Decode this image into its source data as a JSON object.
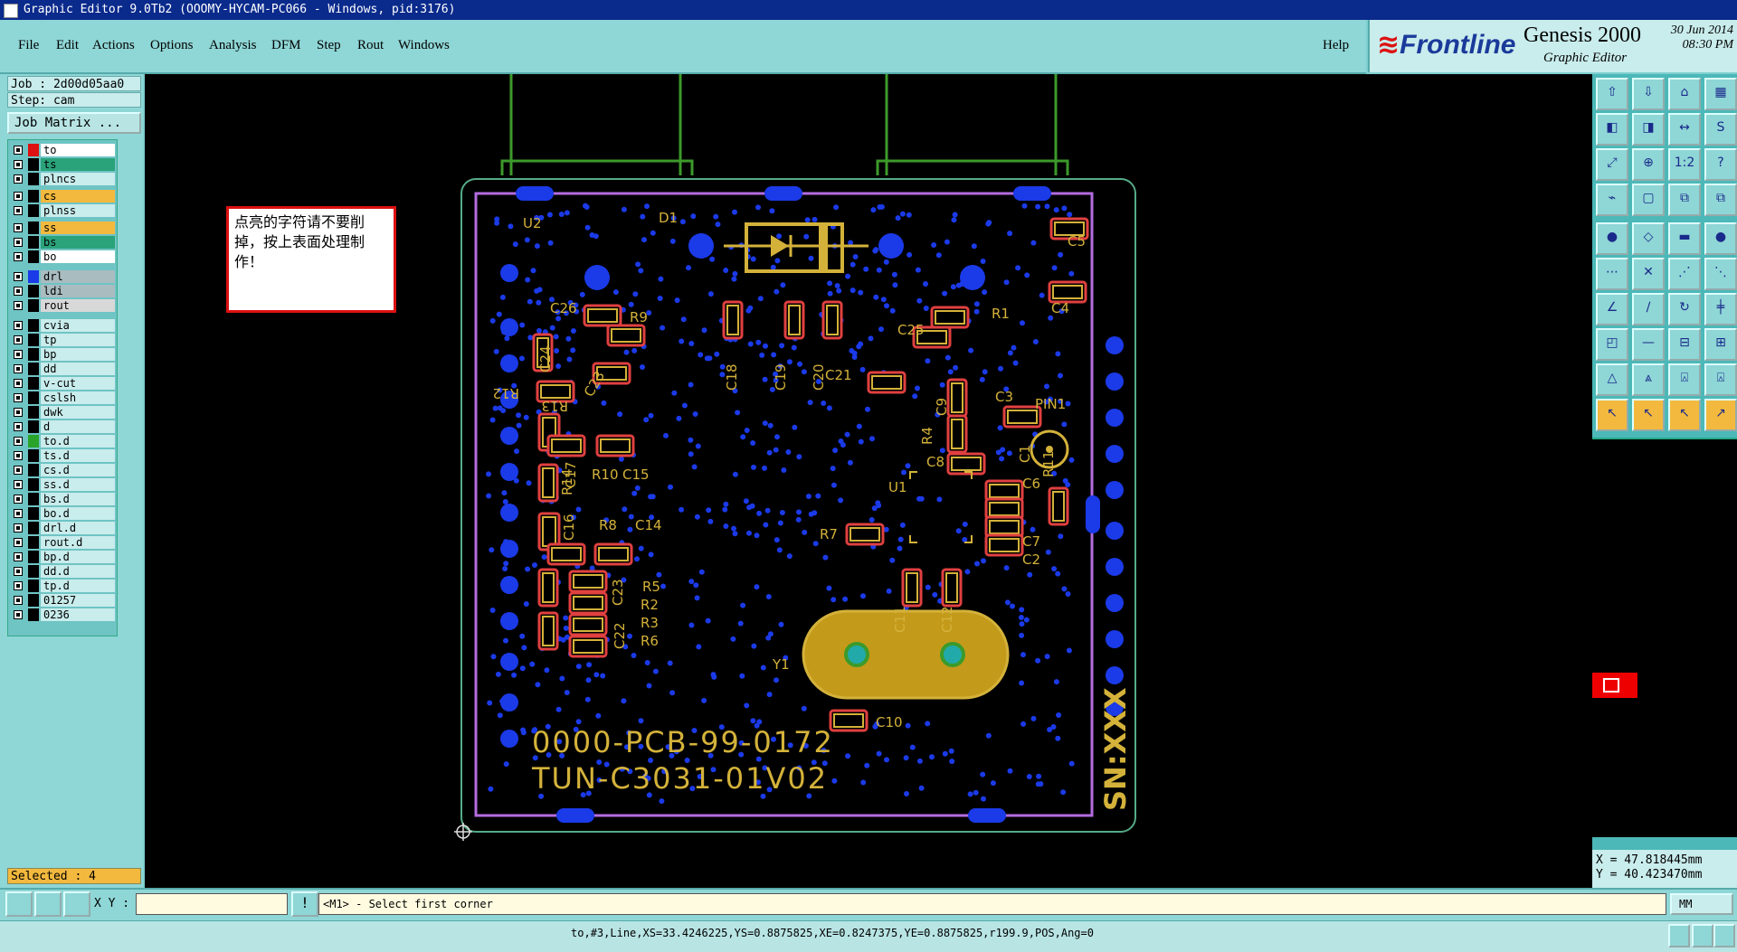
{
  "title_bar": {
    "text": "Graphic Editor 9.0Tb2 (OOOMY-HYCAM-PC066 - Windows, pid:3176)"
  },
  "menus": [
    "File",
    "Edit",
    "Actions",
    "Options",
    "Analysis",
    "DFM",
    "Step",
    "Rout",
    "Windows"
  ],
  "help_label": "Help",
  "brand": {
    "logo_text": "Frontline",
    "product": "Genesis 2000",
    "subtitle": "Graphic Editor",
    "date": "30 Jun 2014",
    "time": "08:30 PM"
  },
  "job": {
    "job_label": "Job : 2d00d05aa0",
    "step_label": "Step: cam",
    "matrix_button": "Job Matrix ..."
  },
  "layers": [
    {
      "name": "to",
      "bg": "#ffffff",
      "sw": "#d11"
    },
    {
      "name": "ts",
      "bg": "#2aa37a",
      "sw": "#000"
    },
    {
      "name": "plncs",
      "bg": "#c9ecec",
      "sw": "#000"
    },
    {
      "name": "cs",
      "bg": "#f3b93e",
      "sw": "#000"
    },
    {
      "name": "plnss",
      "bg": "#c9ecec",
      "sw": "#000"
    },
    {
      "name": "ss",
      "bg": "#f3b93e",
      "sw": "#000"
    },
    {
      "name": "bs",
      "bg": "#2aa37a",
      "sw": "#000"
    },
    {
      "name": "bo",
      "bg": "#ffffff",
      "sw": "#000"
    },
    {
      "name": "drl",
      "bg": "#a9bcc0",
      "sw": "#1b3ae8"
    },
    {
      "name": "ldi",
      "bg": "#a9bcc0",
      "sw": "#000"
    },
    {
      "name": "rout",
      "bg": "#d8d8d8",
      "sw": "#000"
    },
    {
      "name": "cvia",
      "bg": "#c9ecec",
      "sw": "#000"
    },
    {
      "name": "tp",
      "bg": "#c9ecec",
      "sw": "#000"
    },
    {
      "name": "bp",
      "bg": "#c9ecec",
      "sw": "#000"
    },
    {
      "name": "dd",
      "bg": "#c9ecec",
      "sw": "#000"
    },
    {
      "name": "v-cut",
      "bg": "#c9ecec",
      "sw": "#000"
    },
    {
      "name": "cslsh",
      "bg": "#c9ecec",
      "sw": "#000"
    },
    {
      "name": "dwk",
      "bg": "#c9ecec",
      "sw": "#000"
    },
    {
      "name": "d",
      "bg": "#c9ecec",
      "sw": "#000"
    },
    {
      "name": "to.d",
      "bg": "#c9ecec",
      "sw": "#2aa32a"
    },
    {
      "name": "ts.d",
      "bg": "#c9ecec",
      "sw": "#000"
    },
    {
      "name": "cs.d",
      "bg": "#c9ecec",
      "sw": "#000"
    },
    {
      "name": "ss.d",
      "bg": "#c9ecec",
      "sw": "#000"
    },
    {
      "name": "bs.d",
      "bg": "#c9ecec",
      "sw": "#000"
    },
    {
      "name": "bo.d",
      "bg": "#c9ecec",
      "sw": "#000"
    },
    {
      "name": "drl.d",
      "bg": "#c9ecec",
      "sw": "#000"
    },
    {
      "name": "rout.d",
      "bg": "#c9ecec",
      "sw": "#000"
    },
    {
      "name": "bp.d",
      "bg": "#c9ecec",
      "sw": "#000"
    },
    {
      "name": "dd.d",
      "bg": "#c9ecec",
      "sw": "#000"
    },
    {
      "name": "tp.d",
      "bg": "#c9ecec",
      "sw": "#000"
    },
    {
      "name": "01257",
      "bg": "#c9ecec",
      "sw": "#000"
    },
    {
      "name": "0236",
      "bg": "#c9ecec",
      "sw": "#000"
    }
  ],
  "selected_label": "Selected : 4",
  "note_text": "点亮的字符请不要削掉，按上表面处理制作！",
  "pcb": {
    "text_line1": "0000-PCB-99-0172",
    "text_line2": "TUN-C3031-01V02",
    "sn_text": "SN:XXX",
    "labels": [
      "U2",
      "D1",
      "C5",
      "C4",
      "C26",
      "R9",
      "C24",
      "C23",
      "R12",
      "R13",
      "C18",
      "C19",
      "C20",
      "C21",
      "C25",
      "R1",
      "C9",
      "C3",
      "PIN1",
      "R4",
      "C8",
      "C1",
      "R11",
      "C6",
      "U1",
      "C17",
      "R10",
      "C15",
      "R14",
      "C16",
      "R8",
      "C14",
      "R7",
      "C7",
      "C2",
      "C23",
      "R5",
      "R2",
      "R3",
      "R6",
      "C22",
      "C11",
      "C12",
      "Y1",
      "C10"
    ]
  },
  "coords": {
    "x": "X = 47.818445mm",
    "y": "Y = 40.423470mm"
  },
  "xy_label": "X Y :",
  "xy_value": "",
  "message": "<M1> - Select first corner",
  "units": "MM",
  "status_text": "to,#3,Line,XS=33.4246225,YS=0.8875825,XE=0.8247375,YE=0.8875825,r199.9,POS,Ang=0"
}
